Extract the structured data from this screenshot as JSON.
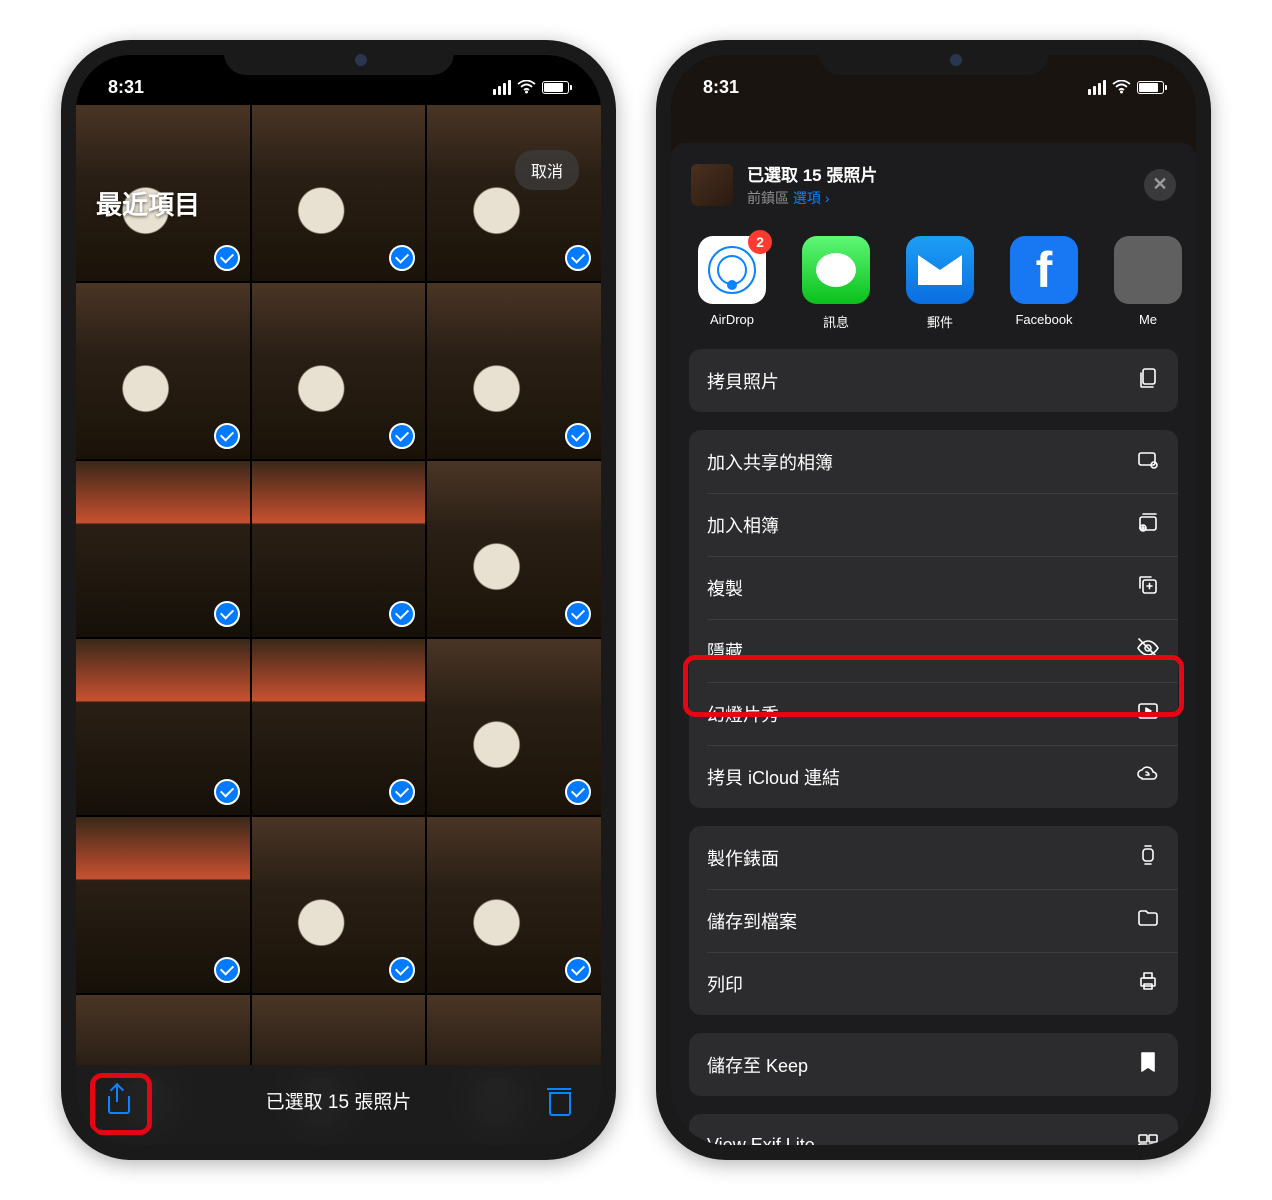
{
  "status_time": "8:31",
  "left": {
    "album_title": "最近項目",
    "cancel": "取消",
    "selected_label": "已選取 15 張照片"
  },
  "right": {
    "selected_title": "已選取 15 張照片",
    "location": "前鎮區",
    "options": "選項",
    "airdrop_badge": "2",
    "apps": {
      "airdrop": "AirDrop",
      "messages": "訊息",
      "mail": "郵件",
      "facebook": "Facebook",
      "more": "Me"
    },
    "actions": {
      "copy": "拷貝照片",
      "shared_album": "加入共享的相簿",
      "add_album": "加入相簿",
      "duplicate": "複製",
      "hide": "隱藏",
      "slideshow": "幻燈片秀",
      "icloud_link": "拷貝 iCloud 連結",
      "watch_face": "製作錶面",
      "save_files": "儲存到檔案",
      "print": "列印",
      "save_keep": "儲存至 Keep",
      "view_exif": "View Exif Lite"
    }
  }
}
